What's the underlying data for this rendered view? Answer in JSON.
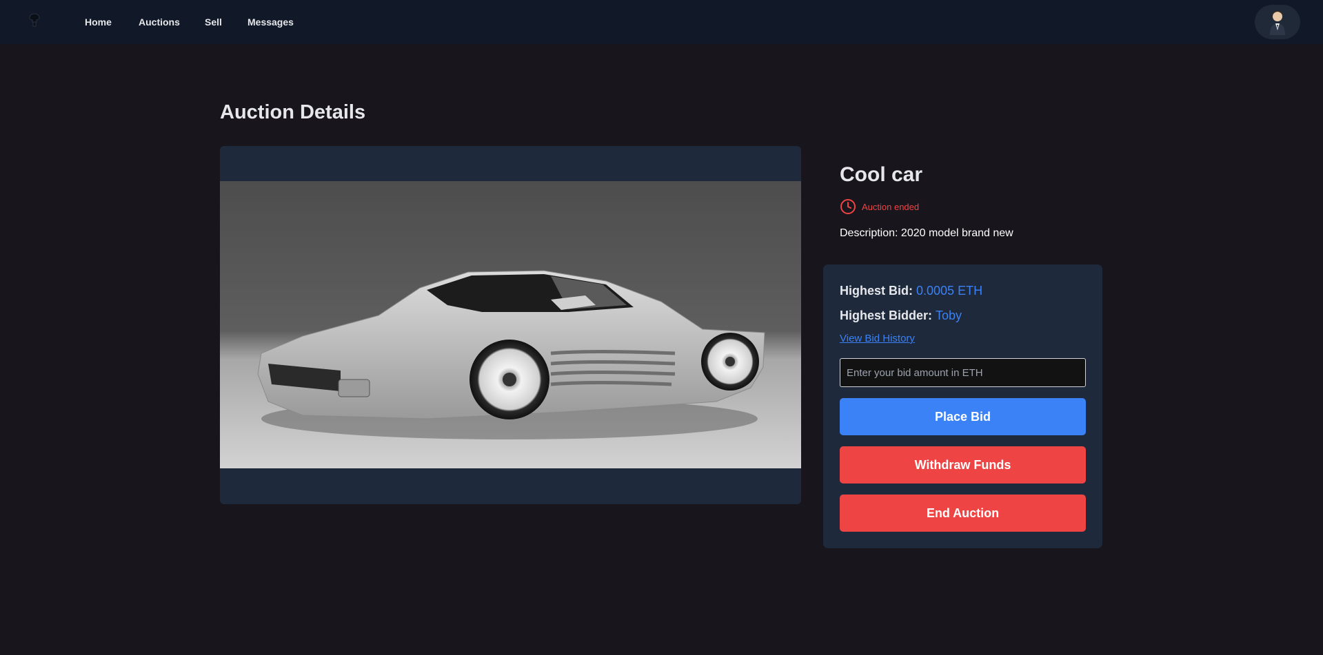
{
  "nav": {
    "links": [
      "Home",
      "Auctions",
      "Sell",
      "Messages"
    ]
  },
  "page": {
    "title": "Auction Details"
  },
  "item": {
    "title": "Cool car",
    "status": "Auction ended",
    "description": "Description: 2020 model brand new"
  },
  "bid": {
    "highest_bid_label": "Highest Bid:",
    "highest_bid_value": "0.0005 ETH",
    "highest_bidder_label": "Highest Bidder:",
    "highest_bidder_value": "Toby",
    "history_link": "View Bid History",
    "input_placeholder": "Enter your bid amount in ETH",
    "place_bid": "Place Bid",
    "withdraw": "Withdraw Funds",
    "end_auction": "End Auction"
  },
  "colors": {
    "accent": "#3b82f6",
    "danger": "#ef4444",
    "navbar": "#111827",
    "panel": "#1e293b",
    "background": "#19151c"
  },
  "icons": [
    "logo-icon",
    "clock-icon",
    "avatar"
  ]
}
